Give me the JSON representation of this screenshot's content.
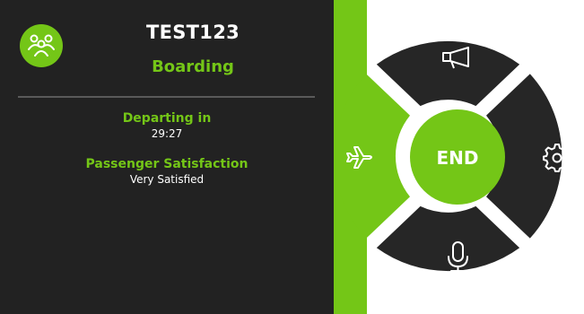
{
  "flight": {
    "id": "TEST123",
    "status": "Boarding"
  },
  "info": {
    "departing_label": "Departing in",
    "departing_value": "29:27",
    "satisfaction_label": "Passenger Satisfaction",
    "satisfaction_value": "Very Satisfied"
  },
  "dial": {
    "center_label": "END",
    "top_icon": "megaphone-icon",
    "right_icon": "gear-icon",
    "bottom_icon": "microphone-icon",
    "left_icon": "airplane-icon"
  },
  "colors": {
    "accent": "#74c617",
    "panel": "#222222",
    "segment": "#262626",
    "background": "#ffffff"
  }
}
